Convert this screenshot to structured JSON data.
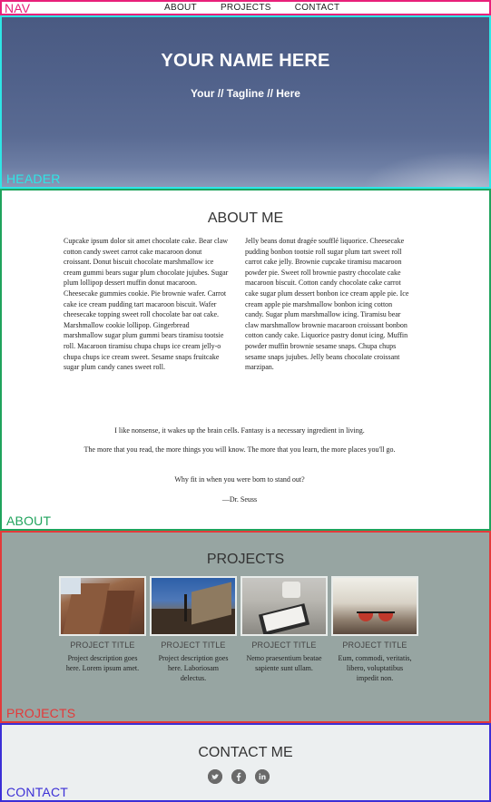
{
  "nav": {
    "label": "NAV",
    "items": [
      "ABOUT",
      "PROJECTS",
      "CONTACT"
    ]
  },
  "header": {
    "label": "HEADER",
    "name": "YOUR NAME HERE",
    "tagline": "Your // Tagline // Here"
  },
  "about": {
    "label": "ABOUT",
    "title": "ABOUT ME",
    "col_left": "Cupcake ipsum dolor sit amet chocolate cake. Bear claw cotton candy sweet carrot cake macaroon donut croissant. Donut biscuit chocolate marshmallow ice cream gummi bears sugar plum chocolate jujubes. Sugar plum lollipop dessert muffin donut macaroon. Cheesecake gummies cookie. Pie brownie wafer. Carrot cake ice cream pudding tart macaroon biscuit. Wafer cheesecake topping sweet roll chocolate bar oat cake. Marshmallow cookie lollipop. Gingerbread marshmallow sugar plum gummi bears tiramisu tootsie roll. Macaroon tiramisu chupa chups ice cream jelly-o chupa chups ice cream sweet. Sesame snaps fruitcake sugar plum candy canes sweet roll.",
    "col_right": "Jelly beans donut dragée soufflé liquorice. Cheesecake pudding bonbon tootsie roll sugar plum tart sweet roll carrot cake jelly. Brownie cupcake tiramisu macaroon powder pie. Sweet roll brownie pastry chocolate cake macaroon biscuit. Cotton candy chocolate cake carrot cake sugar plum dessert bonbon ice cream apple pie. Ice cream apple pie marshmallow bonbon icing cotton candy. Sugar plum marshmallow icing. Tiramisu bear claw marshmallow brownie macaroon croissant bonbon cotton candy cake. Liquorice pastry donut icing. Muffin powder muffin brownie sesame snaps. Chupa chups sesame snaps jujubes. Jelly beans chocolate croissant marzipan.",
    "quote_1": "I like nonsense, it wakes up the brain cells. Fantasy is a necessary ingredient in living.",
    "quote_2": "The more that you read, the more things you will know. The more that you learn, the more places you'll go.",
    "quote_3": "Why fit in when you were born to stand out?",
    "attribution": "—Dr. Seuss"
  },
  "projects": {
    "label": "PROJECTS",
    "title": "PROJECTS",
    "items": [
      {
        "title": "PROJECT TITLE",
        "description": "Project description goes here. Lorem ipsum amet."
      },
      {
        "title": "PROJECT TITLE",
        "description": "Project description goes here. Laboriosam delectus."
      },
      {
        "title": "PROJECT TITLE",
        "description": "Nemo praesentium beatae sapiente sunt ullam."
      },
      {
        "title": "PROJECT TITLE",
        "description": "Eum, commodi, veritatis, libero, voluptatibus impedit non."
      }
    ]
  },
  "contact": {
    "label": "CONTACT",
    "title": "CONTACT ME",
    "social": [
      "twitter-icon",
      "facebook-icon",
      "linkedin-icon"
    ]
  },
  "colors": {
    "nav_border": "#e8207a",
    "header_border": "#2ee6e6",
    "about_border": "#1fa35c",
    "projects_border": "#e33a3a",
    "contact_border": "#3b2fd6",
    "projects_bg": "#97a5a2",
    "contact_bg": "#eceff0"
  }
}
